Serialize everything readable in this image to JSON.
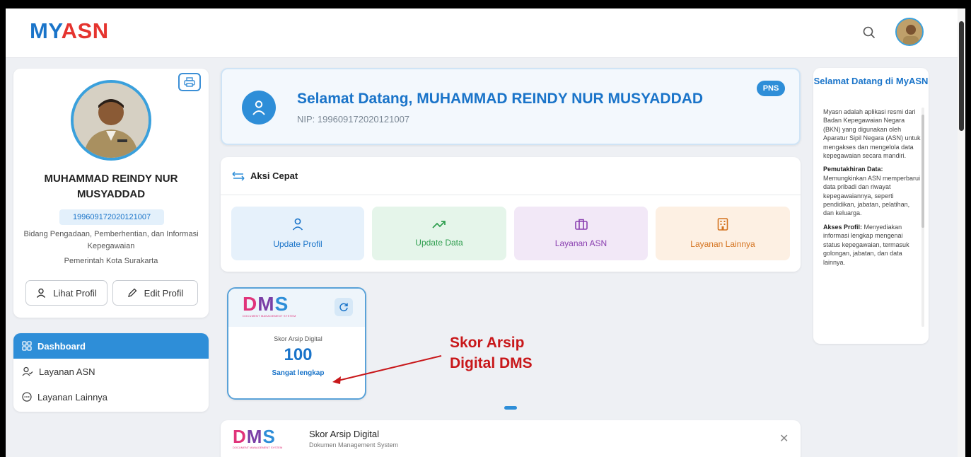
{
  "header": {
    "logo_my": "MY",
    "logo_asn": "ASN"
  },
  "profile": {
    "name": "MUHAMMAD REINDY NUR MUSYADDAD",
    "nip": "199609172020121007",
    "unit": "Bidang Pengadaan, Pemberhentian, dan Informasi Kepegawaian",
    "instansi": "Pemerintah Kota Surakarta",
    "view_button": "Lihat Profil",
    "edit_button": "Edit Profil"
  },
  "sidebar": {
    "items": [
      {
        "label": "Dashboard",
        "icon": "grid-icon",
        "active": true
      },
      {
        "label": "Layanan ASN",
        "icon": "user-check-icon",
        "active": false
      },
      {
        "label": "Layanan Lainnya",
        "icon": "more-circle-icon",
        "active": false
      }
    ]
  },
  "welcome": {
    "title": "Selamat Datang, MUHAMMAD REINDY NUR MUSYADDAD",
    "nip_line": "NIP: 199609172020121007",
    "badge": "PNS"
  },
  "quick_actions": {
    "title": "Aksi Cepat",
    "tiles": [
      {
        "label": "Update Profil",
        "icon": "user-icon",
        "color": "#1a74c9"
      },
      {
        "label": "Update Data",
        "icon": "trending-up-icon",
        "color": "#2f9e4f"
      },
      {
        "label": "Layanan ASN",
        "icon": "briefcase-icon",
        "color": "#8a3fb0"
      },
      {
        "label": "Layanan Lainnya",
        "icon": "building-icon",
        "color": "#d4731f"
      }
    ]
  },
  "dms_widget": {
    "logo": "DMS",
    "logo_sub": "DOCUMENT MANAGEMENT SYSTEM",
    "label": "Skor Arsip Digital",
    "score": "100",
    "status": "Sangat lengkap"
  },
  "dms_bottom": {
    "logo": "DMS",
    "logo_sub": "DOCUMENT MANAGEMENT SYSTEM",
    "title": "Skor Arsip Digital",
    "subtitle": "Dokumen Management System"
  },
  "info_panel": {
    "title": "Selamat Datang di MyASN",
    "intro": "Myasn adalah aplikasi resmi dari Badan Kepegawaian Negara (BKN) yang digunakan oleh Aparatur Sipil Negara (ASN) untuk mengakses dan mengelola data kepegawaian secara mandiri.",
    "sections": [
      {
        "heading": "Pemutakhiran Data:",
        "text": "Memungkinkan ASN memperbarui data pribadi dan riwayat kepegawaiannya, seperti pendidikan, jabatan, pelatihan, dan keluarga."
      },
      {
        "heading": "Akses Profil:",
        "text": "Menyediakan informasi lengkap mengenai status kepegawaian, termasuk golongan, jabatan, dan data lainnya."
      }
    ]
  },
  "annotation": {
    "line1": "Skor Arsip",
    "line2": "Digital DMS",
    "color": "#c8171a"
  }
}
